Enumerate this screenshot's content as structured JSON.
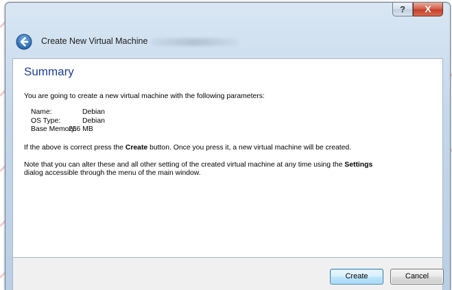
{
  "window": {
    "title": "Create New Virtual Machine",
    "help_label": "?",
    "close_label": "X"
  },
  "page": {
    "heading": "Summary",
    "intro": "You are going to create a new virtual machine with the following parameters:",
    "params": [
      {
        "label": "Name:",
        "value": "Debian"
      },
      {
        "label": "OS Type:",
        "value": "Debian"
      },
      {
        "label": "Base Memory:",
        "value": "256 MB"
      }
    ],
    "confirm_pre": "If the above is correct press the ",
    "confirm_bold": "Create",
    "confirm_post": " button. Once you press it, a new virtual machine will be created.",
    "note_pre": "Note that you can alter these and all other setting of the created virtual machine at any time using the ",
    "note_bold": "Settings",
    "note_line2": "dialog accessible through the menu of the main window."
  },
  "buttons": {
    "create": "Create",
    "cancel": "Cancel"
  },
  "colors": {
    "heading": "#1e3f8e",
    "close_button": "#c4412a",
    "watermark": "#e8a0a0"
  },
  "icons": {
    "back": "back-arrow-icon"
  }
}
